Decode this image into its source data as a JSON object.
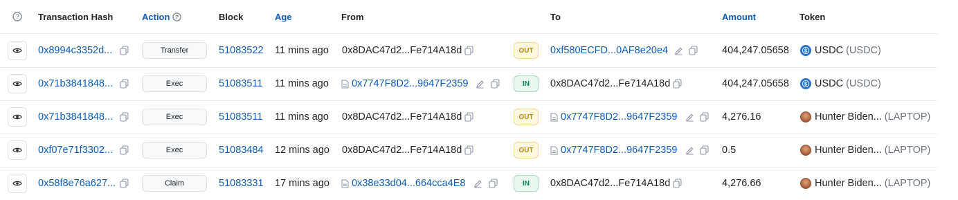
{
  "headers": {
    "tx_hash": "Transaction Hash",
    "action": "Action",
    "block": "Block",
    "age": "Age",
    "from": "From",
    "to": "To",
    "amount": "Amount",
    "token": "Token"
  },
  "colors": {
    "link": "#0d5cba",
    "out_badge": "#fff8e1",
    "in_badge": "#e9f7ef",
    "usdc": "#2775ca"
  },
  "icons": [
    "help-circle-icon",
    "eye-icon",
    "copy-icon",
    "contract-file-icon",
    "edit-pencil-icon",
    "usdc-token-icon",
    "laptop-token-icon"
  ],
  "rows": [
    {
      "hash": "0x8994c3352d...",
      "action": "Transfer",
      "block": "51083522",
      "age": "11 mins ago",
      "from": "0x8DAC47d2...Fe714A18d",
      "dir": "OUT",
      "to": "0xf580ECFD...0AF8e20e4",
      "amount": "404,247.05658",
      "token_name": "USDC",
      "token_symbol": "(USDC)"
    },
    {
      "hash": "0x71b3841848...",
      "action": "Exec",
      "block": "51083511",
      "age": "11 mins ago",
      "from": "0x7747F8D2...9647F2359",
      "dir": "IN",
      "to": "0x8DAC47d2...Fe714A18d",
      "amount": "404,247.05658",
      "token_name": "USDC",
      "token_symbol": "(USDC)"
    },
    {
      "hash": "0x71b3841848...",
      "action": "Exec",
      "block": "51083511",
      "age": "11 mins ago",
      "from": "0x8DAC47d2...Fe714A18d",
      "dir": "OUT",
      "to": "0x7747F8D2...9647F2359",
      "amount": "4,276.16",
      "token_name": "Hunter Biden...",
      "token_symbol": "(LAPTOP)"
    },
    {
      "hash": "0xf07e71f3302...",
      "action": "Exec",
      "block": "51083484",
      "age": "12 mins ago",
      "from": "0x8DAC47d2...Fe714A18d",
      "dir": "OUT",
      "to": "0x7747F8D2...9647F2359",
      "amount": "0.5",
      "token_name": "Hunter Biden...",
      "token_symbol": "(LAPTOP)"
    },
    {
      "hash": "0x58f8e76a627...",
      "action": "Claim",
      "block": "51083331",
      "age": "17 mins ago",
      "from": "0x38e33d04...664cca4E8",
      "dir": "IN",
      "to": "0x8DAC47d2...Fe714A18d",
      "amount": "4,276.66",
      "token_name": "Hunter Biden...",
      "token_symbol": "(LAPTOP)"
    }
  ]
}
